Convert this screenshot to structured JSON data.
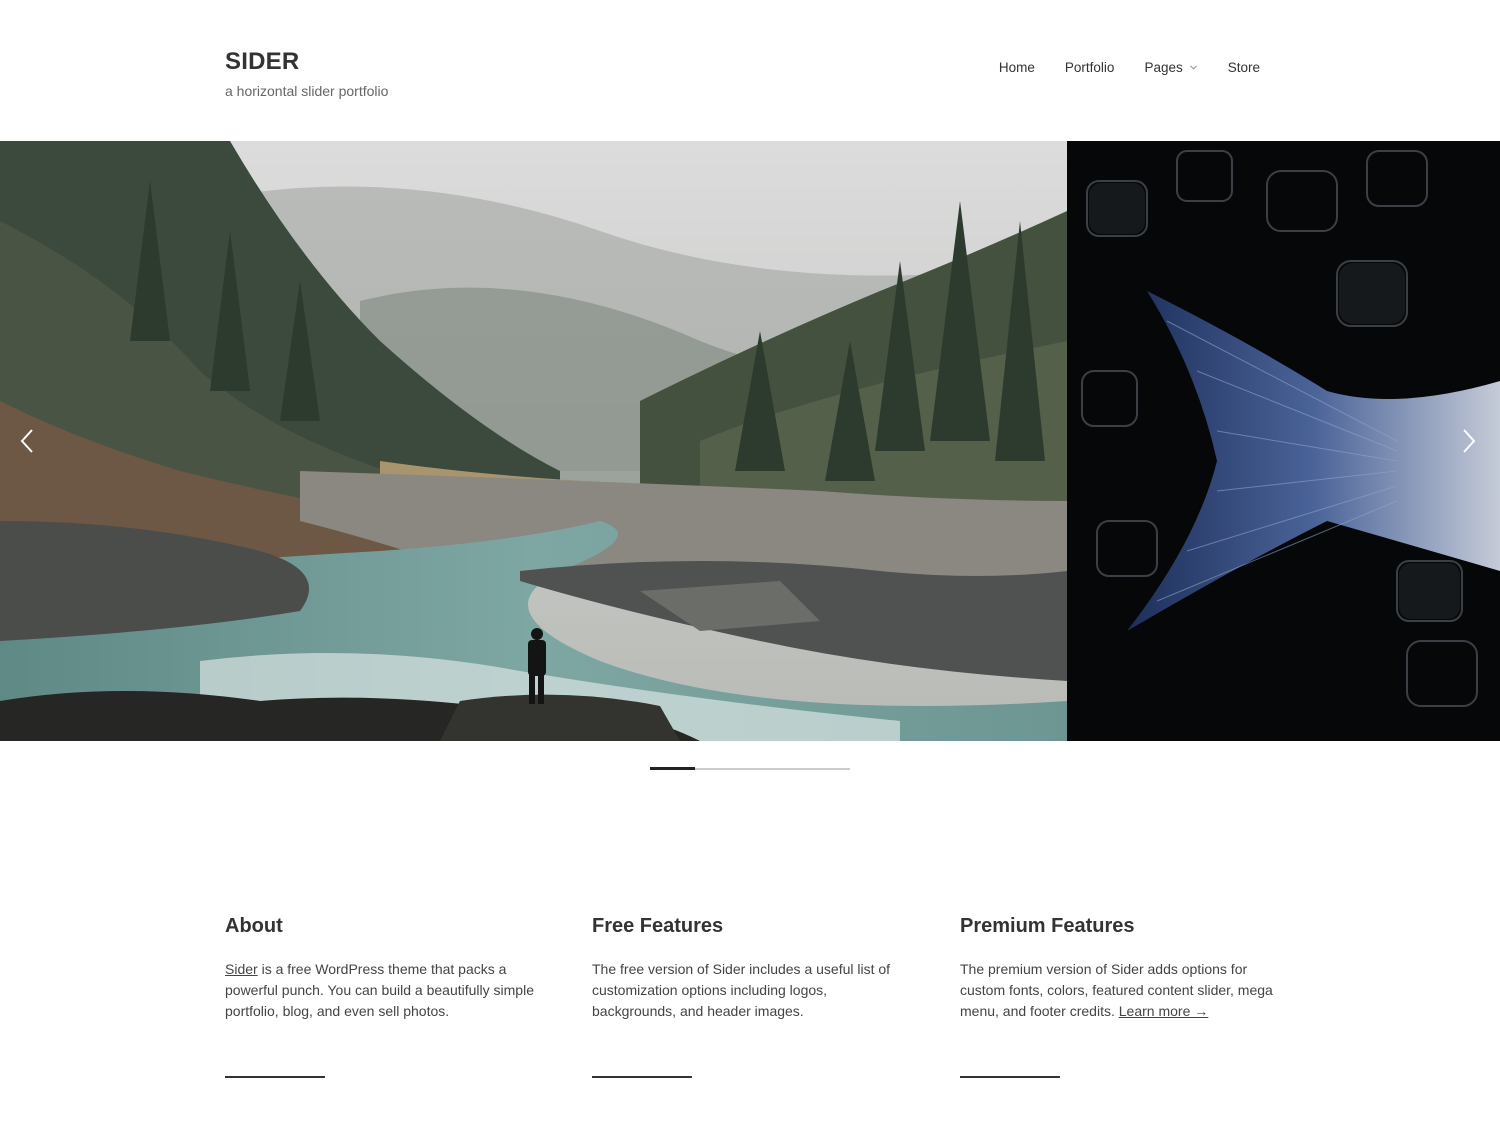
{
  "site": {
    "title": "SIDER",
    "tagline": "a horizontal slider portfolio"
  },
  "nav": {
    "items": [
      {
        "label": "Home"
      },
      {
        "label": "Portfolio"
      },
      {
        "label": "Pages",
        "has_submenu": true
      },
      {
        "label": "Store"
      }
    ]
  },
  "slider": {
    "slides": [
      {
        "subject": "misty forest valley with river and a person standing on rocks"
      },
      {
        "subject": "blue fish tail on black background with ice cubes"
      }
    ],
    "prev_icon": "chevron-left-icon",
    "next_icon": "chevron-right-icon",
    "progress": 0.225
  },
  "widgets": {
    "about": {
      "title": "About",
      "link_text": "Sider",
      "text": " is a free WordPress theme that packs a powerful punch. You can build a beautifully simple portfolio, blog, and even sell photos."
    },
    "free": {
      "title": "Free Features",
      "text": "The free version of Sider includes a useful list of customization options including logos, backgrounds, and header images."
    },
    "premium": {
      "title": "Premium Features",
      "text": "The premium version of Sider adds options for custom fonts, colors, featured content slider, mega menu, and footer credits. ",
      "link_text": "Learn more →"
    }
  },
  "colors": {
    "text": "#333333",
    "muted": "#666666",
    "progress_track": "#cccccc",
    "progress_fill": "#222222"
  }
}
